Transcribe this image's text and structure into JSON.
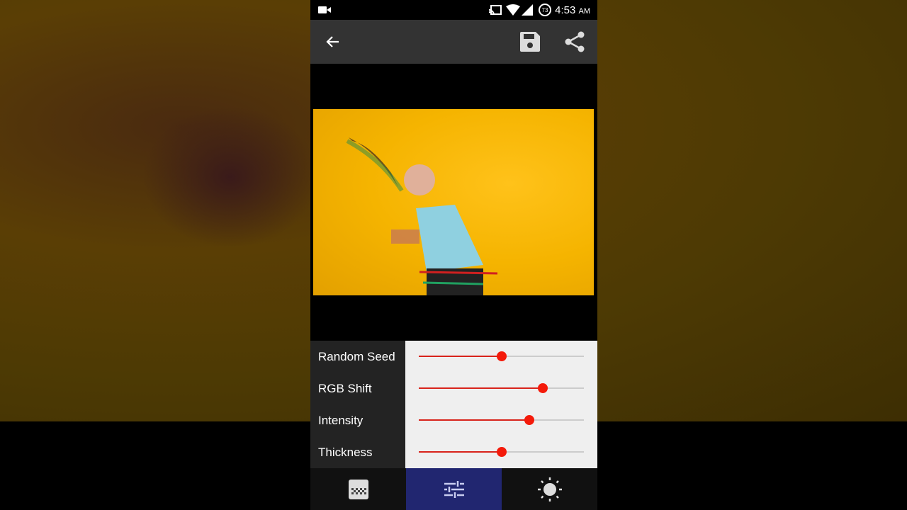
{
  "status_bar": {
    "time": "4:53",
    "ampm": "AM",
    "battery": "73"
  },
  "app_bar": {
    "back_icon": "arrow-left-icon",
    "save_icon": "save-icon",
    "share_icon": "share-icon"
  },
  "controls": [
    {
      "label": "Random Seed",
      "value_percent": 50
    },
    {
      "label": "RGB Shift",
      "value_percent": 75
    },
    {
      "label": "Intensity",
      "value_percent": 67
    },
    {
      "label": "Thickness",
      "value_percent": 50
    }
  ],
  "bottom_nav": [
    {
      "icon": "texture-icon",
      "active": false
    },
    {
      "icon": "tune-sliders-icon",
      "active": true
    },
    {
      "icon": "brightness-icon",
      "active": false
    }
  ],
  "colors": {
    "accent": "#f41a0a",
    "active_tab": "#212670"
  }
}
